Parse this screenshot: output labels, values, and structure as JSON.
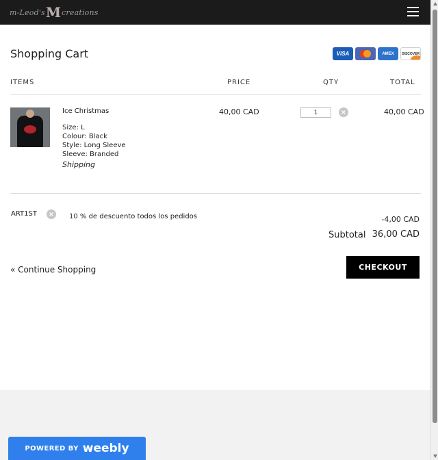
{
  "header": {
    "logo_prefix": "m-Leod's",
    "logo_initial": "M",
    "logo_suffix": "creations",
    "menu_icon": "hamburger-icon"
  },
  "cart": {
    "title": "Shopping Cart",
    "payment_cards": [
      "VISA",
      "Mastercard",
      "AMEX",
      "DISCOVER"
    ],
    "columns": {
      "items": "ITEMS",
      "price": "PRICE",
      "qty": "QTY",
      "total": "TOTAL"
    },
    "item": {
      "name": "Ice Christmas",
      "options": [
        "Size: L",
        "Colour: Black",
        "Style: Long Sleeve",
        "Sleeve: Branded"
      ],
      "shipping": "Shipping",
      "price": "40,00 CAD",
      "qty": "1",
      "total": "40,00 CAD"
    },
    "coupon": {
      "code": "ART1ST",
      "description": "10 % de descuento todos los pedidos",
      "discount": "-4,00 CAD"
    },
    "subtotal_label": "Subtotal",
    "subtotal_value": "36,00 CAD",
    "continue_label": "« Continue Shopping",
    "checkout_label": "CHECKOUT"
  },
  "badge": {
    "powered_by": "POWERED BY",
    "brand": "weebly"
  },
  "colors": {
    "header_bg": "#1b1b1b",
    "checkout_bg": "#000000",
    "badge_bg": "#2f80ed",
    "footer_bg": "#f2f2f2"
  }
}
